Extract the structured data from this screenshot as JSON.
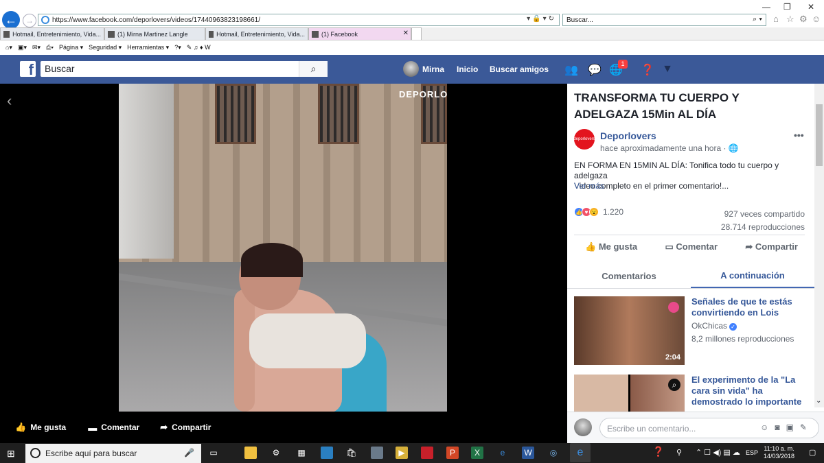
{
  "browser": {
    "url": "https://www.facebook.com/deporlovers/videos/17440963823198661/",
    "search_placeholder": "Buscar...",
    "tabs": [
      {
        "label": "Hotmail, Entretenimiento, Vida..."
      },
      {
        "label": "(1) Mirna Martinez Langle"
      },
      {
        "label": "Hotmail, Entretenimiento, Vida..."
      },
      {
        "label": "(1) Facebook"
      }
    ],
    "command_bar": [
      "Página ▾",
      "Seguridad ▾",
      "Herramientas ▾"
    ]
  },
  "facebook": {
    "search_placeholder": "Buscar",
    "user_name": "Mirna",
    "nav": [
      "Inicio",
      "Buscar amigos"
    ],
    "notification_count": "1"
  },
  "video": {
    "watermark": "DEPORLOVERS",
    "actions": [
      "Me gusta",
      "Comentar",
      "Compartir"
    ]
  },
  "post": {
    "title": "TRANSFORMA TU CUERPO Y ADELGAZA 15Min AL DÍA",
    "page_name": "Deporlovers",
    "logo_text": "deporlovers",
    "time": "hace aproximadamente una hora",
    "description_line1": "EN FORMA EN 15MIN AL DÍA: Tonifica todo tu cuerpo y adelgaza",
    "description_line2": "Video completo en el primer comentario!...",
    "see_more": "Ver más",
    "reactions_count": "1.220",
    "shares": "927 veces compartido",
    "views": "28.714 reproducciones",
    "actions": [
      "Me gusta",
      "Comentar",
      "Compartir"
    ],
    "tabs": [
      "Comentarios",
      "A continuación"
    ]
  },
  "related": [
    {
      "title": "Señales de que te estás convirtiendo en Lois",
      "channel": "OkChicas",
      "views": "8,2 millones reproducciones",
      "duration": "2:04"
    },
    {
      "title": "El experimento de la \"La cara sin vida\" ha demostrado lo importante",
      "channel": "",
      "views": "",
      "duration": ""
    }
  ],
  "comment": {
    "placeholder": "Escribe un comentario..."
  },
  "taskbar": {
    "search_placeholder": "Escribe aquí para buscar",
    "lang": "ESP",
    "time": "11:10 a. m.",
    "date": "14/03/2018"
  },
  "colors": {
    "facebook_blue": "#3b5998",
    "link_blue": "#365899",
    "brand_red": "#e3141e"
  }
}
